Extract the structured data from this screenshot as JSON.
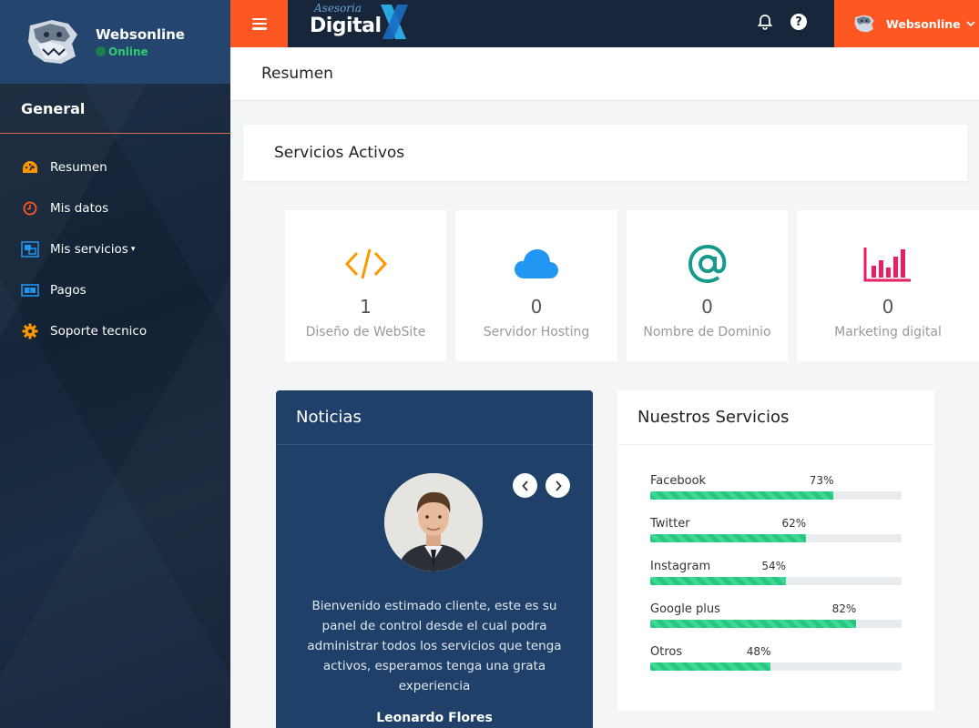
{
  "sidebar": {
    "user": {
      "name": "Websonline",
      "status": "Online"
    },
    "menu_header": "General",
    "items": [
      {
        "label": "Resumen",
        "icon": "dashboard-icon",
        "color": "#ff9800"
      },
      {
        "label": "Mis datos",
        "icon": "clock-icon",
        "color": "#ff5722"
      },
      {
        "label": "Mis servicios",
        "icon": "services-icon",
        "color": "#2196f3",
        "has_caret": true
      },
      {
        "label": "Pagos",
        "icon": "money-icon",
        "color": "#2196f3"
      },
      {
        "label": "Soporte tecnico",
        "icon": "gear-icon",
        "color": "#ff9800"
      }
    ]
  },
  "topbar": {
    "logo_small": "Asesoria",
    "logo_big": "Digital",
    "user_label": "Websonline"
  },
  "page": {
    "title": "Resumen"
  },
  "section": {
    "title": "Servicios Activos"
  },
  "stats": [
    {
      "value": "1",
      "label": "Diseño de WebSite",
      "icon": "code-icon",
      "color": "#ff9800"
    },
    {
      "value": "0",
      "label": "Servidor Hosting",
      "icon": "cloud-icon",
      "color": "#2196f3"
    },
    {
      "value": "0",
      "label": "Nombre de Dominio",
      "icon": "at-icon",
      "color": "#159a8c"
    },
    {
      "value": "0",
      "label": "Marketing digital",
      "icon": "chart-icon",
      "color": "#e91e63"
    }
  ],
  "news": {
    "title": "Noticias",
    "text": "Bienvenido estimado cliente, este es su panel de control desde el cual podra administrar todos los servicios que tenga activos, esperamos tenga una grata experiencia",
    "author": "Leonardo Flores"
  },
  "services": {
    "title": "Nuestros Servicios",
    "items": [
      {
        "name": "Facebook",
        "percent_label": "73%",
        "percent": 73
      },
      {
        "name": "Twitter",
        "percent_label": "62%",
        "percent": 62
      },
      {
        "name": "Instagram",
        "percent_label": "54%",
        "percent": 54
      },
      {
        "name": "Google plus",
        "percent_label": "82%",
        "percent": 82
      },
      {
        "name": "Otros",
        "percent_label": "48%",
        "percent": 48
      }
    ]
  },
  "colors": {
    "accent": "#ff5722",
    "topbar": "#17263a",
    "news_bg": "#1f4068",
    "progress": "#27c77f"
  }
}
